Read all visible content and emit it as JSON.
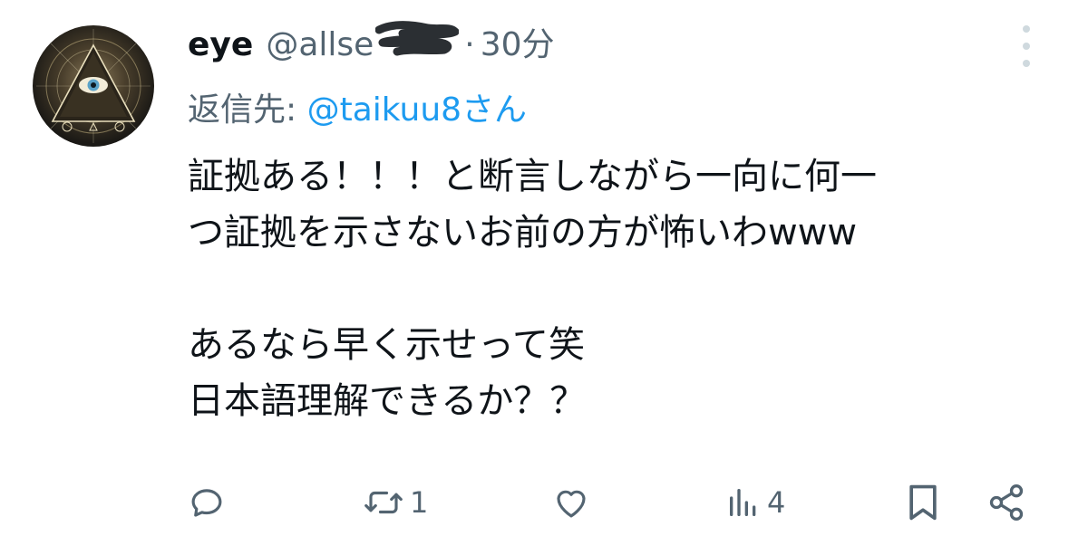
{
  "tweet": {
    "display_name": "eye",
    "handle": "@allse",
    "separator": "·",
    "time": "30分",
    "reply_label": "返信先: ",
    "reply_user": "@taikuu8さん",
    "lines": [
      "証拠ある！！！と断言しながら一向に何一",
      "つ証拠を示さないお前の方が怖いわwww",
      "",
      "あるなら早く示せって笑",
      "日本語理解できるか？？"
    ]
  },
  "actions": {
    "reply": {
      "icon": "reply-icon",
      "count": ""
    },
    "retweet": {
      "icon": "retweet-icon",
      "count": "1"
    },
    "like": {
      "icon": "heart-icon",
      "count": ""
    },
    "views": {
      "icon": "views-icon",
      "count": "4"
    },
    "bookmark": {
      "icon": "bookmark-icon"
    },
    "share": {
      "icon": "share-icon"
    }
  },
  "colors": {
    "text": "#0f1419",
    "secondary": "#536471",
    "link": "#1d9bf0",
    "background": "#ffffff"
  }
}
